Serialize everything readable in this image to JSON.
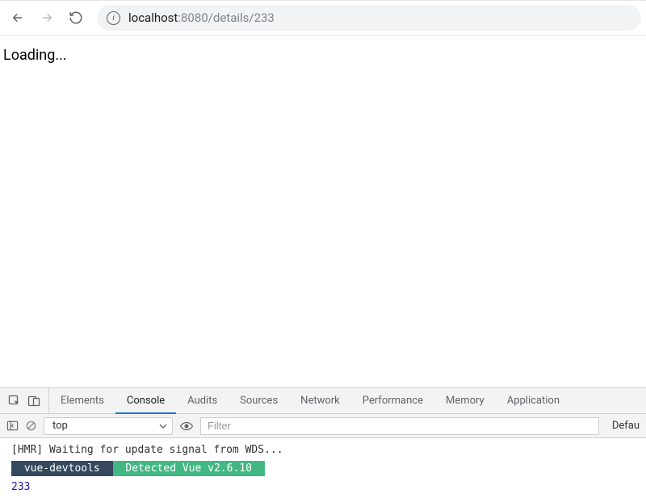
{
  "browser": {
    "url_host": "localhost",
    "url_path": ":8080/details/233"
  },
  "page": {
    "loading_text": "Loading..."
  },
  "devtools": {
    "tabs": {
      "elements": "Elements",
      "console": "Console",
      "audits": "Audits",
      "sources": "Sources",
      "network": "Network",
      "performance": "Performance",
      "memory": "Memory",
      "application": "Application"
    },
    "context": "top",
    "filter_placeholder": "Filter",
    "levels_label": "Defau",
    "logs": {
      "hmr": "[HMR] Waiting for update signal from WDS...",
      "badge1": " vue-devtools ",
      "badge2": " Detected Vue v2.6.10 ",
      "num": "233"
    }
  }
}
